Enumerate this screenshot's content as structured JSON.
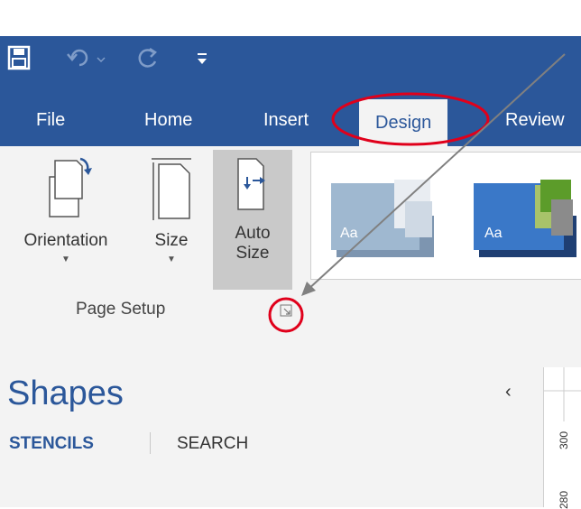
{
  "tabs": {
    "file": "File",
    "home": "Home",
    "insert": "Insert",
    "design": "Design",
    "review": "Review"
  },
  "page_setup": {
    "orientation": "Orientation",
    "size": "Size",
    "auto_size_line1": "Auto",
    "auto_size_line2": "Size",
    "group_label": "Page Setup"
  },
  "themes": {
    "tile_label": "Aa"
  },
  "shapes_panel": {
    "title": "Shapes",
    "tab_stencils": "STENCILS",
    "tab_search": "SEARCH"
  },
  "ruler": {
    "tick_a": "300",
    "tick_b": "280"
  },
  "colors": {
    "brand_blue": "#2b579a",
    "annotation_red": "#e0001b",
    "annotation_arrow": "#808080"
  },
  "icons": [
    "save-icon",
    "undo-icon",
    "redo-icon",
    "customize-qat-icon",
    "page-setup-launcher-icon",
    "collapse-panel-icon"
  ]
}
